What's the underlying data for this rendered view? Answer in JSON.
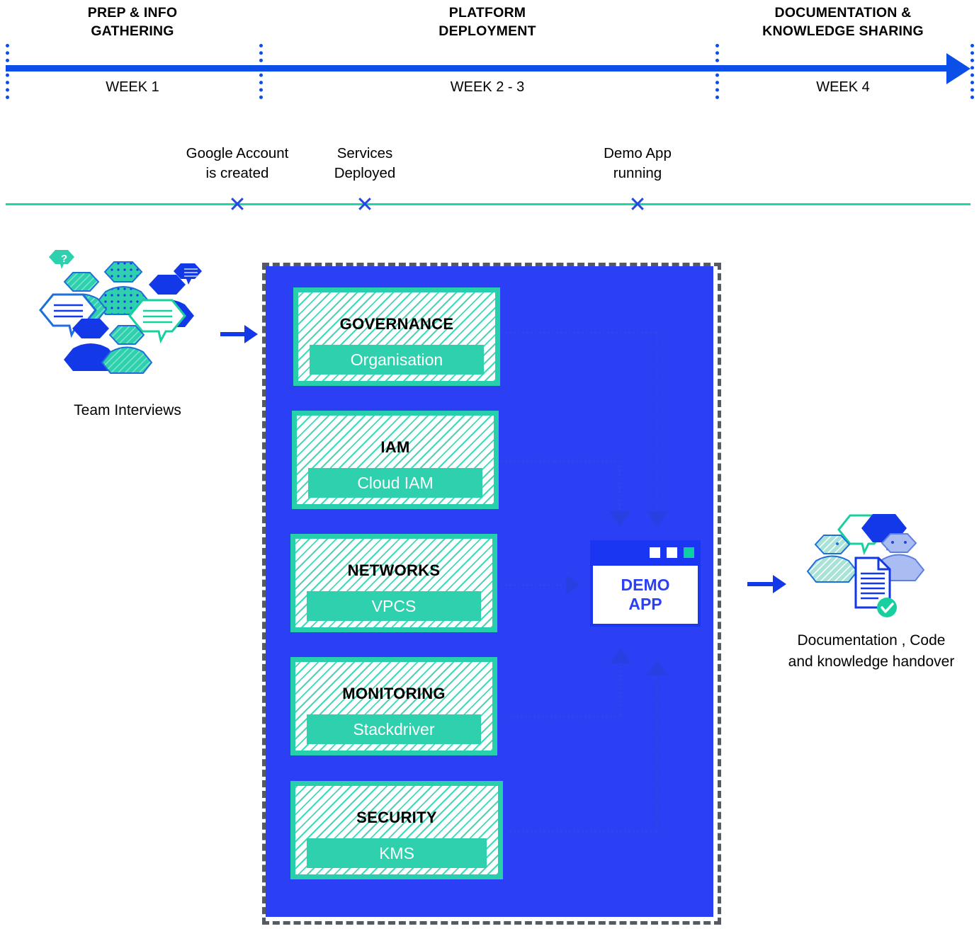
{
  "timeline": {
    "phases": [
      {
        "title": "PREP & INFO\nGATHERING",
        "week": "WEEK 1"
      },
      {
        "title": "PLATFORM\nDEPLOYMENT",
        "week": "WEEK 2 - 3"
      },
      {
        "title": "DOCUMENTATION &\nKNOWLEDGE SHARING",
        "week": "WEEK 4"
      }
    ],
    "axis_color": "#0b4fe8"
  },
  "milestones": {
    "line_color": "#1fd6a5",
    "marker_color": "#2549e0",
    "items": [
      {
        "label": "Google Account\nis created"
      },
      {
        "label": "Services\nDeployed"
      },
      {
        "label": "Demo App\nrunning"
      }
    ]
  },
  "left_section": {
    "caption": "Team Interviews",
    "icon": "team-interviews-icon"
  },
  "platform": {
    "panel_color": "#2b40f4",
    "border_color": "#545b63",
    "accent_color": "#2ed0ad",
    "layers": [
      {
        "title": "GOVERNANCE",
        "service": "Organisation"
      },
      {
        "title": "IAM",
        "service": "Cloud IAM"
      },
      {
        "title": "NETWORKS",
        "service": "VPCS"
      },
      {
        "title": "MONITORING",
        "service": "Stackdriver"
      },
      {
        "title": "SECURITY",
        "service": "KMS"
      }
    ],
    "demo_app": {
      "line1": "DEMO",
      "line2": "APP",
      "text_color": "#2b40f4"
    }
  },
  "right_section": {
    "caption": "Documentation , Code\nand knowledge handover",
    "icon": "documentation-handover-icon"
  }
}
